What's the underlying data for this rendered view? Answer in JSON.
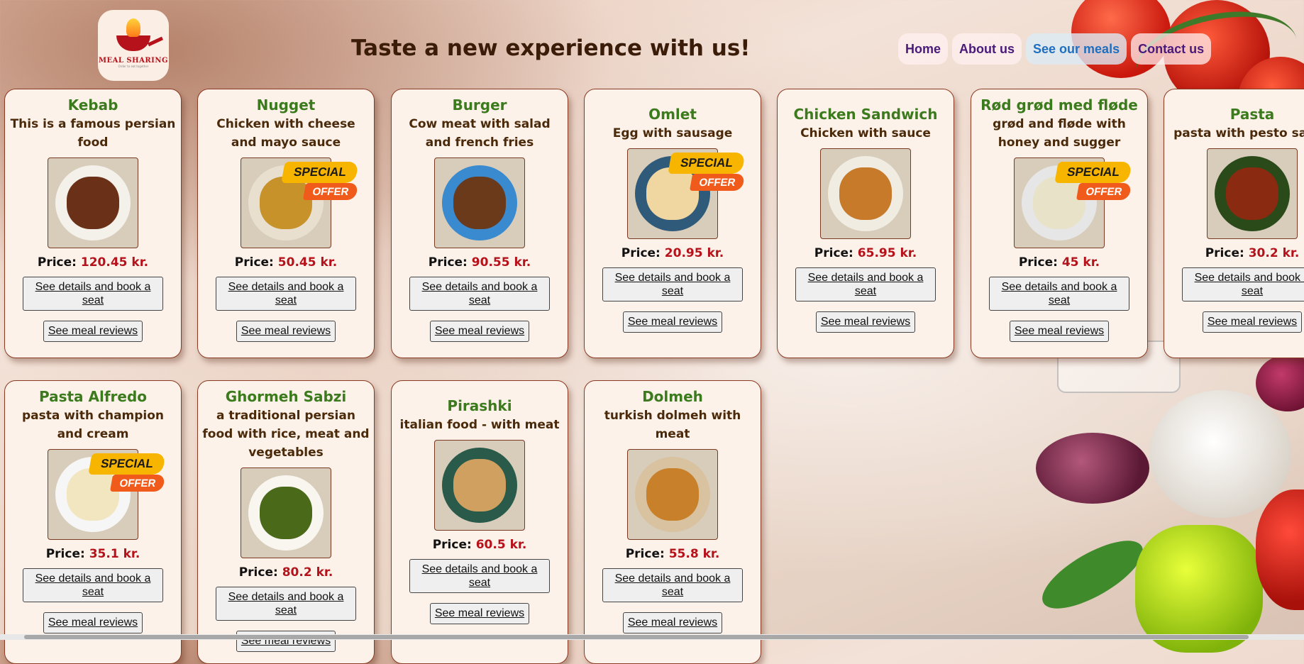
{
  "header": {
    "logo_title": "MEAL SHARING",
    "logo_sub": "Order to eat together",
    "tagline": "Taste a new experience with us!"
  },
  "nav": [
    {
      "label": "Home",
      "active": false
    },
    {
      "label": "About us",
      "active": false
    },
    {
      "label": "See our meals",
      "active": true
    },
    {
      "label": "Contact us",
      "active": false
    }
  ],
  "labels": {
    "price": "Price:",
    "details_button": "See details and book a seat",
    "reviews_button": "See meal reviews",
    "special_top": "SPECIAL",
    "special_bottom": "OFFER"
  },
  "meals": [
    {
      "title": "Kebab",
      "description": "This is a famous persian food",
      "price": "120.45 kr.",
      "special": false
    },
    {
      "title": "Nugget",
      "description": "Chicken with cheese and mayo sauce",
      "price": "50.45 kr.",
      "special": true
    },
    {
      "title": "Burger",
      "description": "Cow meat with salad and french fries",
      "price": "90.55 kr.",
      "special": false
    },
    {
      "title": "Omlet",
      "description": "Egg with sausage",
      "price": "20.95 kr.",
      "special": true
    },
    {
      "title": "Chicken Sandwich",
      "description": "Chicken with sauce",
      "price": "65.95 kr.",
      "special": false
    },
    {
      "title": "Rød grød med fløde",
      "description": "grød and fløde with honey and sugger",
      "price": "45 kr.",
      "special": true
    },
    {
      "title": "Pasta",
      "description": "pasta with pesto sauce",
      "price": "30.2 kr.",
      "special": false
    },
    {
      "title": "Pasta Alfredo",
      "description": "pasta with champion and cream",
      "price": "35.1 kr.",
      "special": true
    },
    {
      "title": "Ghormeh Sabzi",
      "description": "a traditional persian food with rice, meat and vegetables",
      "price": "80.2 kr.",
      "special": false
    },
    {
      "title": "Pirashki",
      "description": "italian food - with meat",
      "price": "60.5 kr.",
      "special": false
    },
    {
      "title": "Dolmeh",
      "description": "turkish dolmeh with meat",
      "price": "55.8 kr.",
      "special": false
    }
  ],
  "food_colors": [
    "#6b3018",
    "#c8922a",
    "#6a3a1a",
    "#f0d6a0",
    "#c77a2a",
    "#e8e2c8",
    "#8a2a10",
    "#f2e6c0",
    "#4a6a1a",
    "#d0a060",
    "#c8802a"
  ],
  "plate_colors": [
    "#f4f1ea",
    "#e8dfcf",
    "#3a8ad0",
    "#2f5a7a",
    "#f0ece2",
    "#e6e6e6",
    "#2a4a1a",
    "#f6f6f6",
    "#f8f6ef",
    "#2a5a4a",
    "#d8c2a0"
  ]
}
